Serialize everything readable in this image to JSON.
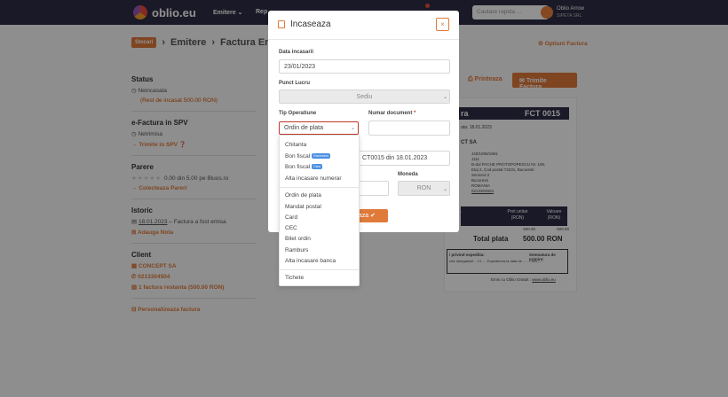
{
  "nav": {
    "logo": "oblio.eu",
    "items": [
      "Emitere ⌄",
      "Rep"
    ],
    "search_placeholder": "Cautare rapida ...",
    "user_name": "Oblio Arrow",
    "user_company": "SIPETA SRL"
  },
  "breadcrumb": {
    "badge": "Stocari",
    "items": [
      "Emitere",
      "Factura Emisa"
    ]
  },
  "options_link": "Optiuni Factura",
  "sidebar": {
    "status_title": "Status",
    "status_value": "Neincasata",
    "status_rest": "(Rest de incasat 500.00 RON)",
    "spv_title": "e-Factura in SPV",
    "spv_value": "Netrimisa",
    "spv_action": "Trimite in SPV",
    "rating_title": "Parere",
    "rating_text": "0.00 din 5.00 pe Bluos.ro",
    "rating_action": "Colecteaza Pareri",
    "history_title": "Istoric",
    "history_date": "18.01.2023",
    "history_text": " – Factura a fost emisa",
    "history_action": "Adauga Nota",
    "client_title": "Client",
    "client_name": "CONCEPT SA",
    "client_phone": "0213304504",
    "client_debt": "1 factura restanta (500.00 RON)",
    "customize": "Personalizeaza factura"
  },
  "actions": {
    "print": "Printeaza",
    "send": "Trimite Factura"
  },
  "invoice": {
    "title_fragment": "ra",
    "number": "FCT 0015",
    "date": "ata: 18.01.2023",
    "client": "CT SA",
    "reg": "J40/1090/1991",
    "cif": "1111",
    "addr1": "B-dul PACHE PROTOPOPESCU Nr. 109,",
    "addr2": "Etaj 2, Cod postal 73231, Bucuresti",
    "addr3": "Sectorul 2",
    "city": "Bucuresti",
    "country": "ROMANIA",
    "phone": "0213304504",
    "col_price": "Pret unitar",
    "col_price_unit": "(RON)",
    "col_value": "Valoare",
    "col_value_unit": "(RON)",
    "row_price": "500.00",
    "row_value": "500.00",
    "total_label": "Total plata",
    "total_value": "500.00 RON",
    "ship_title": "i privind expeditia:",
    "ship_text": "rele delegatului: - CI: - -  Expedierea la data de .........ora.......",
    "sign_title": "Semnatura de primire:",
    "footer": "Emis cu Oblio Gratuit : ",
    "footer_link": "www.oblio.eu"
  },
  "modal": {
    "title": "Incaseaza",
    "close": "×",
    "date_label": "Data incasarii",
    "date_value": "23/01/2023",
    "workpoint_label": "Punct Lucru",
    "workpoint_value": "Sediu",
    "type_label": "Tip Operatiune",
    "type_value": "Ordin de plata",
    "docnum_label": "Numar document",
    "docnum_required": "*",
    "desc_value": "CT0015 din 18.01.2023",
    "currency_label": "Moneda",
    "currency_value": "RON",
    "save_label": "eaza ✔"
  },
  "dropdown": {
    "group1": [
      "Chitanta",
      "Bon fiscal",
      "Bon fiscal",
      "Alta incasare numerar"
    ],
    "badge1": "Eveniment",
    "badge2": "Card",
    "group2": [
      "Ordin de plata",
      "Mandat postal",
      "Card",
      "CEC",
      "Bilet ordin",
      "Ramburs",
      "Alta incasare banca"
    ],
    "group3": [
      "Tichete"
    ]
  }
}
